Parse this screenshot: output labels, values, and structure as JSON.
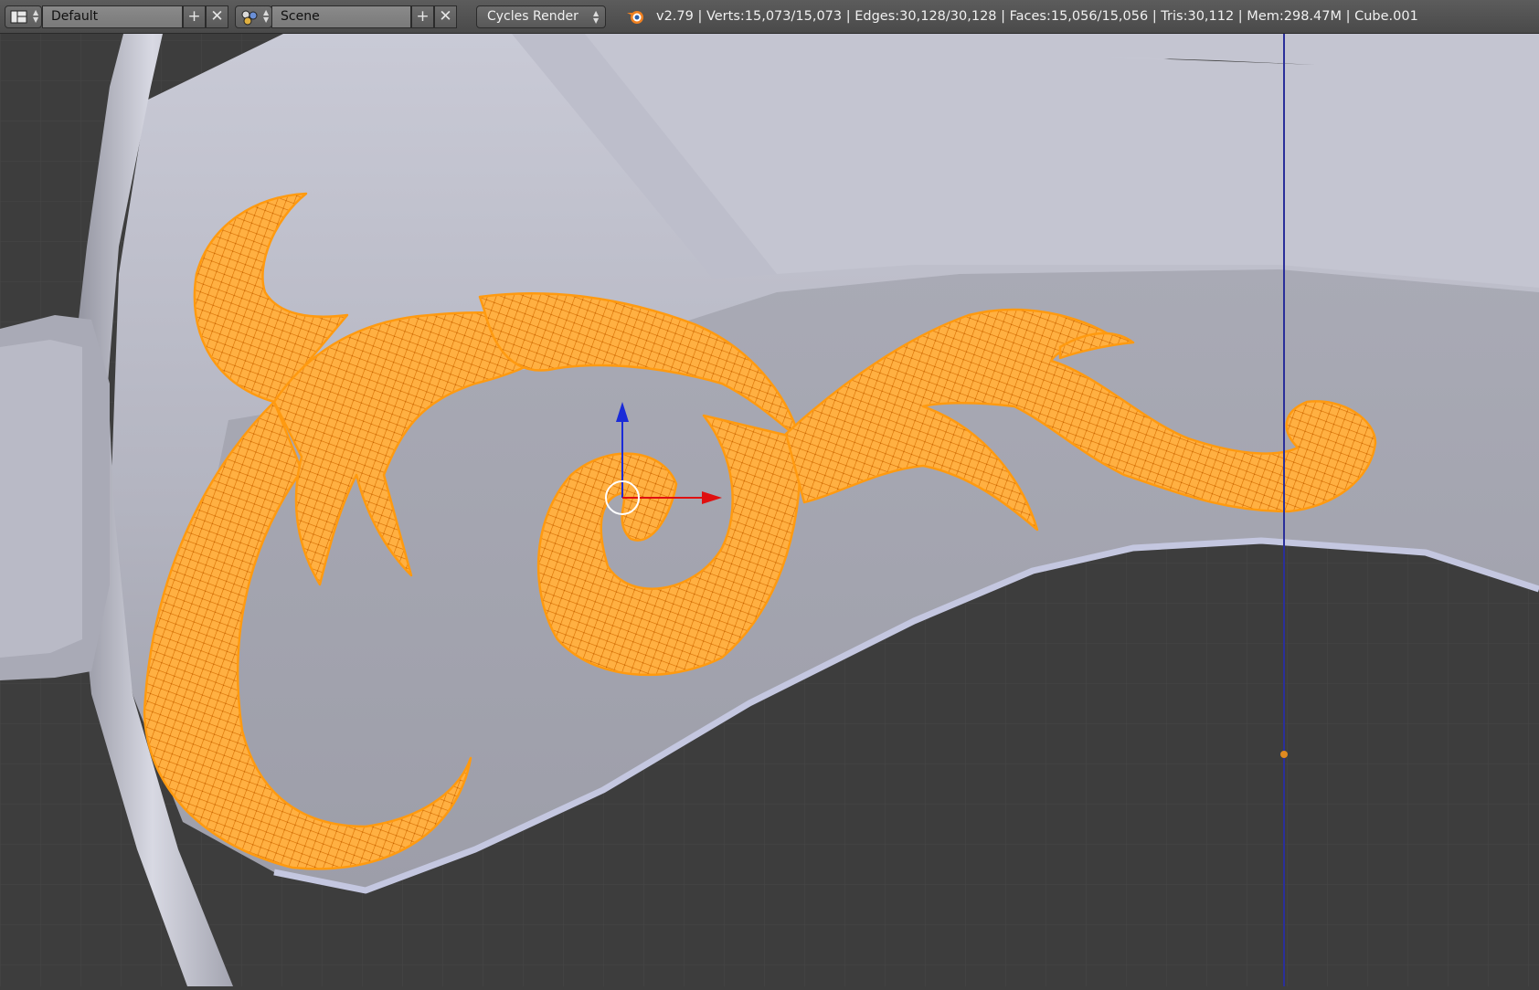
{
  "header": {
    "layout_name": "Default",
    "scene_name": "Scene",
    "render_engine": "Cycles Render",
    "stats": "v2.79 | Verts:15,073/15,073 | Edges:30,128/30,128 | Faces:15,056/15,056 | Tris:30,112 | Mem:298.47M | Cube.001"
  },
  "icons": {
    "editor_type": "layout-screens-icon",
    "scene_type": "scene-icon",
    "add": "plus-icon",
    "remove": "x-icon",
    "blender": "blender-logo-icon"
  },
  "colors": {
    "selection": "#ff9f1a",
    "background": "#3d3d3d",
    "mesh": "#a7a9ba",
    "x_axis": "#e01010",
    "z_axis": "#1020e0"
  }
}
